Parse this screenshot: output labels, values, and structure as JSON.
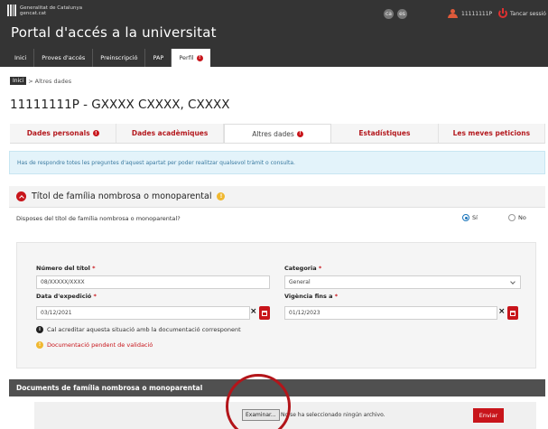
{
  "header": {
    "org_line1": "Generalitat de Catalunya",
    "org_line2": "gencat.cat",
    "icon_btn1": "ca",
    "icon_btn2": "es",
    "user_id": "11111111P",
    "logout_label": "Tancar sessió",
    "portal_title": "Portal d'accés a la universitat"
  },
  "nav": {
    "items": [
      {
        "label": "Inici"
      },
      {
        "label": "Proves d'accés"
      },
      {
        "label": "Preinscripció"
      },
      {
        "label": "PAP"
      },
      {
        "label": "Perfil",
        "badge": "!"
      }
    ]
  },
  "breadcrumb": {
    "home": "Inici",
    "separator": ">",
    "current": "Altres dades"
  },
  "page_title": "11111111P - GXXXX CXXXX, CXXXX",
  "tabs": [
    {
      "label": "Dades personals",
      "badge": "!"
    },
    {
      "label": "Dades acadèmiques"
    },
    {
      "label": "Altres dades",
      "badge": "!"
    },
    {
      "label": "Estadístiques"
    },
    {
      "label": "Les meves peticions"
    }
  ],
  "info_message": "Has de respondre totes les preguntes d'aquest apartat per poder realitzar qualsevol tràmit o consulta.",
  "panel": {
    "title": "Títol de família nombrosa o monoparental",
    "warn": "!",
    "question": "Disposes del títol de família nombrosa o monoparental?",
    "option_yes": "Sí",
    "option_no": "No",
    "selected": "Sí"
  },
  "form": {
    "title_number_label": "Número del títol",
    "title_number_value": "08/XXXXX/XXXX",
    "category_label": "Categoria",
    "category_value": "General",
    "issue_date_label": "Data d'expedició",
    "issue_date_value": "03/12/2021",
    "valid_until_label": "Vigència fins a",
    "valid_until_value": "01/12/2023",
    "required_mark": "*",
    "clear_symbol": "×",
    "note_icon": "i",
    "note_text": "Cal acreditar aquesta situació amb la documentació corresponent",
    "warn_icon": "!",
    "pending_text": "Documentació pendent de validació"
  },
  "documents": {
    "heading": "Documents de família nombrosa o monoparental",
    "browse_label": "Examinar...",
    "no_file_text": "No se ha seleccionado ningún archivo.",
    "send_label": "Enviar"
  },
  "colors": {
    "header_bg": "#343434",
    "accent_red": "#c8151b",
    "info_bg": "#e3f3fa",
    "warning": "#f0b830"
  }
}
